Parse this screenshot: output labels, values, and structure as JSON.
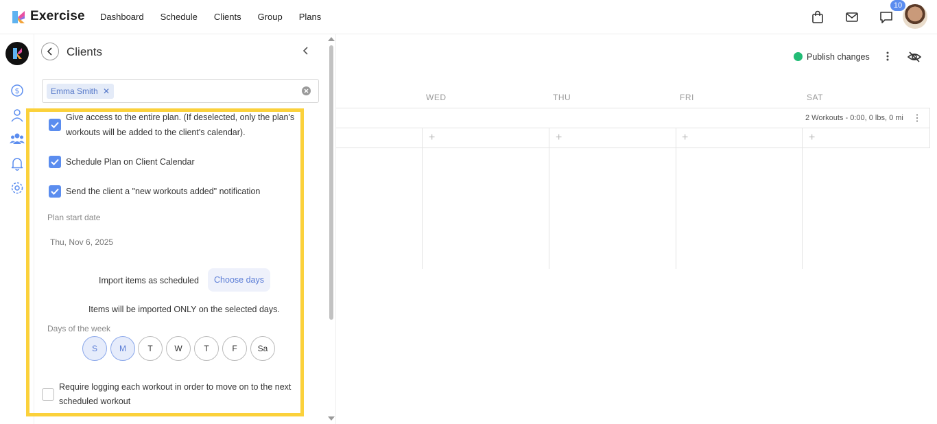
{
  "header": {
    "brand": "Exercise",
    "nav": [
      "Dashboard",
      "Schedule",
      "Clients",
      "Group",
      "Plans"
    ],
    "badge_count": "10"
  },
  "panel": {
    "title": "Clients",
    "selected_client": "Emma Smith",
    "options": [
      {
        "label": "Give access to the entire plan. (If deselected, only the plan's",
        "label2": "workouts will be added to the client's calendar).",
        "checked": true
      },
      {
        "label": "Schedule Plan on Client Calendar",
        "checked": true
      },
      {
        "label": "Send the client a \"new workouts added\" notification",
        "checked": true
      }
    ],
    "start_date_label": "Plan start date",
    "start_date_value": "Thu, Nov 6, 2025",
    "import_label": "Import items as scheduled",
    "choose_days": "Choose days",
    "import_note": "Items will be imported ONLY on the selected days.",
    "days_label": "Days of the week",
    "days": [
      {
        "label": "S",
        "selected": true
      },
      {
        "label": "M",
        "selected": true
      },
      {
        "label": "T",
        "selected": false
      },
      {
        "label": "W",
        "selected": false
      },
      {
        "label": "T",
        "selected": false
      },
      {
        "label": "F",
        "selected": false
      },
      {
        "label": "Sa",
        "selected": false
      }
    ],
    "require_logging": "Require logging each workout in order to move on to the next",
    "require_logging2": "scheduled workout",
    "require_checked": false
  },
  "calendar": {
    "publish": "Publish changes",
    "days": [
      "WED",
      "THU",
      "FRI",
      "SAT"
    ],
    "summary": "2 Workouts - 0:00, 0 lbs, 0 mi",
    "plus": "+"
  },
  "colors": {
    "accent": "#5b8def",
    "highlight": "#fbd13b",
    "publish": "#22bc76"
  }
}
